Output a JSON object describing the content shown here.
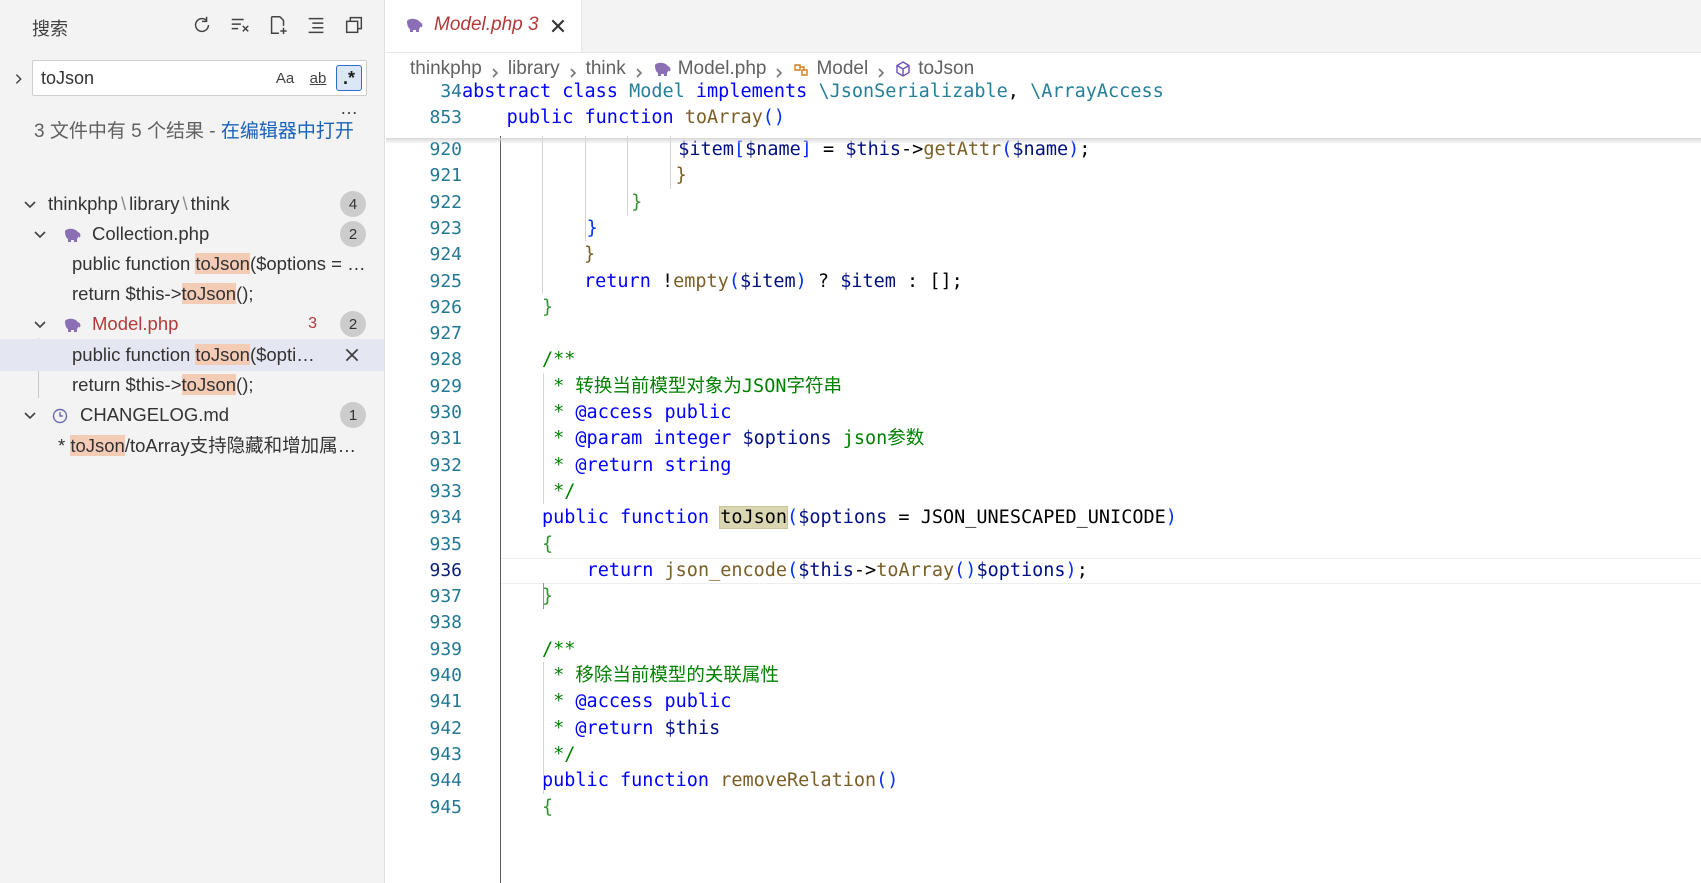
{
  "sidebar": {
    "title": "搜索",
    "actions": [
      "refresh-icon",
      "clear-results-icon",
      "new-search-editor-icon",
      "collapse-all-icon",
      "view-as-tree-icon"
    ],
    "search": {
      "value": "toJson",
      "placeholder": "搜索",
      "options": {
        "match_case": "Aa",
        "whole_word": "ab",
        "regex": ".*"
      }
    },
    "more": "…",
    "result_summary": "3 文件中有 5 个结果 - ",
    "open_in_editor": "在编辑器中打开",
    "tree": {
      "folder": {
        "parts": [
          "thinkphp",
          "library",
          "think"
        ],
        "sep": "\\",
        "count": "4"
      },
      "files": [
        {
          "name": "Collection.php",
          "count": "2",
          "matches": [
            {
              "before": "public function ",
              "hit": "toJson",
              "after": "($options = …"
            },
            {
              "before": "return $this->",
              "hit": "toJson",
              "after": "();"
            }
          ]
        },
        {
          "name": "Model.php",
          "modified": "3",
          "count": "2",
          "matches": [
            {
              "before": "public function ",
              "hit": "toJson",
              "after": "($opti…"
            },
            {
              "before": "return $this->",
              "hit": "toJson",
              "after": "();"
            }
          ]
        }
      ],
      "changelog": {
        "name": "CHANGELOG.md",
        "count": "1",
        "match": {
          "before": "* ",
          "hit": "toJson",
          "after": "/toArray支持隐藏和增加属…"
        }
      }
    }
  },
  "editor": {
    "tab": {
      "label": "Model.php 3"
    },
    "breadcrumb": [
      "thinkphp",
      "library",
      "think",
      "Model.php",
      "Model",
      "toJson"
    ],
    "sticky": [
      {
        "ln": "34",
        "parts": [
          [
            "k",
            "abstract "
          ],
          [
            "k",
            "class "
          ],
          [
            "t",
            "Model "
          ],
          [
            "k",
            "implements "
          ],
          [
            "t",
            "\\JsonSerializable"
          ],
          [
            "",
            "",
            ""
          ],
          [
            "",
            ", "
          ],
          [
            "t",
            "\\ArrayAccess"
          ]
        ]
      },
      {
        "ln": "853",
        "parts": [
          [
            "",
            "    "
          ],
          [
            "k",
            "public "
          ],
          [
            "k",
            "function "
          ],
          [
            "f",
            "toArray"
          ],
          [
            "p",
            "()"
          ]
        ]
      }
    ],
    "lines": [
      {
        "ln": "920",
        "parts": [
          [
            "",
            "                "
          ],
          [
            "v",
            "$item"
          ],
          [
            "p",
            "["
          ],
          [
            "v",
            "$name"
          ],
          [
            "p",
            "]"
          ],
          [
            "",
            " = "
          ],
          [
            "v",
            "$this"
          ],
          [
            "",
            "->"
          ],
          [
            "f",
            "getAttr"
          ],
          [
            "p",
            "("
          ],
          [
            "v",
            "$name"
          ],
          [
            "p",
            ")"
          ],
          [
            "",
            ";"
          ]
        ]
      },
      {
        "ln": "921",
        "parts": [
          [
            "",
            "            "
          ],
          [
            "f",
            "}"
          ]
        ]
      },
      {
        "ln": "922",
        "parts": [
          [
            "",
            "        "
          ],
          [
            "g",
            "}"
          ]
        ]
      },
      {
        "ln": "923",
        "parts": [
          [
            "",
            "    "
          ],
          [
            "p",
            "}"
          ]
        ]
      },
      {
        "ln": "924",
        "parts": [
          [
            "f",
            "}"
          ]
        ]
      },
      {
        "ln": "925",
        "parts": [
          [
            "k",
            "return "
          ],
          [
            "",
            "!"
          ],
          [
            "f",
            "empty"
          ],
          [
            "p",
            "("
          ],
          [
            "v",
            "$item"
          ],
          [
            "p",
            ")"
          ],
          [
            "",
            " ? "
          ],
          [
            "v",
            "$item"
          ],
          [
            "",
            " : [];"
          ]
        ]
      },
      {
        "ln": "926",
        "parts": [
          [
            "g",
            "}"
          ]
        ]
      },
      {
        "ln": "927",
        "parts": []
      },
      {
        "ln": "928",
        "parts": [
          [
            "c",
            "/**"
          ]
        ]
      },
      {
        "ln": "929",
        "parts": [
          [
            "c",
            " * 转换当前模型对象为JSON字符串"
          ]
        ]
      },
      {
        "ln": "930",
        "parts": [
          [
            "c",
            " * "
          ],
          [
            "ct",
            "@access"
          ],
          [
            "c",
            " "
          ],
          [
            "k",
            "public"
          ]
        ]
      },
      {
        "ln": "931",
        "parts": [
          [
            "c",
            " * "
          ],
          [
            "ct",
            "@param"
          ],
          [
            "c",
            " "
          ],
          [
            "k",
            "integer"
          ],
          [
            "c",
            " "
          ],
          [
            "v",
            "$options"
          ],
          [
            "c",
            " json参数"
          ]
        ]
      },
      {
        "ln": "932",
        "parts": [
          [
            "c",
            " * "
          ],
          [
            "ct",
            "@return"
          ],
          [
            "c",
            " "
          ],
          [
            "k",
            "string"
          ]
        ]
      },
      {
        "ln": "933",
        "parts": [
          [
            "c",
            " */"
          ]
        ]
      },
      {
        "ln": "934",
        "parts": [
          [
            "k",
            "public "
          ],
          [
            "k",
            "function "
          ],
          [
            "hl",
            "toJson"
          ],
          [
            "p",
            "("
          ],
          [
            "v",
            "$options"
          ],
          [
            "",
            " = JSON_UNESCAPED_UNICODE"
          ],
          [
            "p",
            ")"
          ]
        ]
      },
      {
        "ln": "935",
        "parts": [
          [
            "g",
            "{"
          ]
        ]
      },
      {
        "ln": "936",
        "parts": [
          [
            "",
            "    "
          ],
          [
            "k",
            "return "
          ],
          [
            "f",
            "json_encode"
          ],
          [
            "p",
            "("
          ],
          [
            "v",
            "$this"
          ],
          [
            "",
            "->"
          ],
          [
            "f",
            "toArray"
          ],
          [
            "p",
            "()"
          ],
          [
            ", "
          ],
          [
            "v",
            "$options"
          ],
          [
            "p",
            ")"
          ],
          [
            "",
            ";"
          ]
        ]
      },
      {
        "ln": "937",
        "parts": [
          [
            "g",
            "}"
          ]
        ]
      },
      {
        "ln": "938",
        "parts": []
      },
      {
        "ln": "939",
        "parts": [
          [
            "c",
            "/**"
          ]
        ]
      },
      {
        "ln": "940",
        "parts": [
          [
            "c",
            " * 移除当前模型的关联属性"
          ]
        ]
      },
      {
        "ln": "941",
        "parts": [
          [
            "c",
            " * "
          ],
          [
            "ct",
            "@access"
          ],
          [
            "c",
            " "
          ],
          [
            "k",
            "public"
          ]
        ]
      },
      {
        "ln": "942",
        "parts": [
          [
            "c",
            " * "
          ],
          [
            "ct",
            "@return"
          ],
          [
            "c",
            " "
          ],
          [
            "v",
            "$this"
          ]
        ]
      },
      {
        "ln": "943",
        "parts": [
          [
            "c",
            " */"
          ]
        ]
      },
      {
        "ln": "944",
        "parts": [
          [
            "k",
            "public "
          ],
          [
            "k",
            "function "
          ],
          [
            "f",
            "removeRelation"
          ],
          [
            "p",
            "()"
          ]
        ]
      },
      {
        "ln": "945",
        "parts": [
          [
            "g",
            "{"
          ]
        ]
      }
    ],
    "current_line": "936"
  },
  "colors": {
    "accent": "#2e6fd0",
    "modified": "#b33a3a",
    "highlight": "#f4ccb6"
  }
}
